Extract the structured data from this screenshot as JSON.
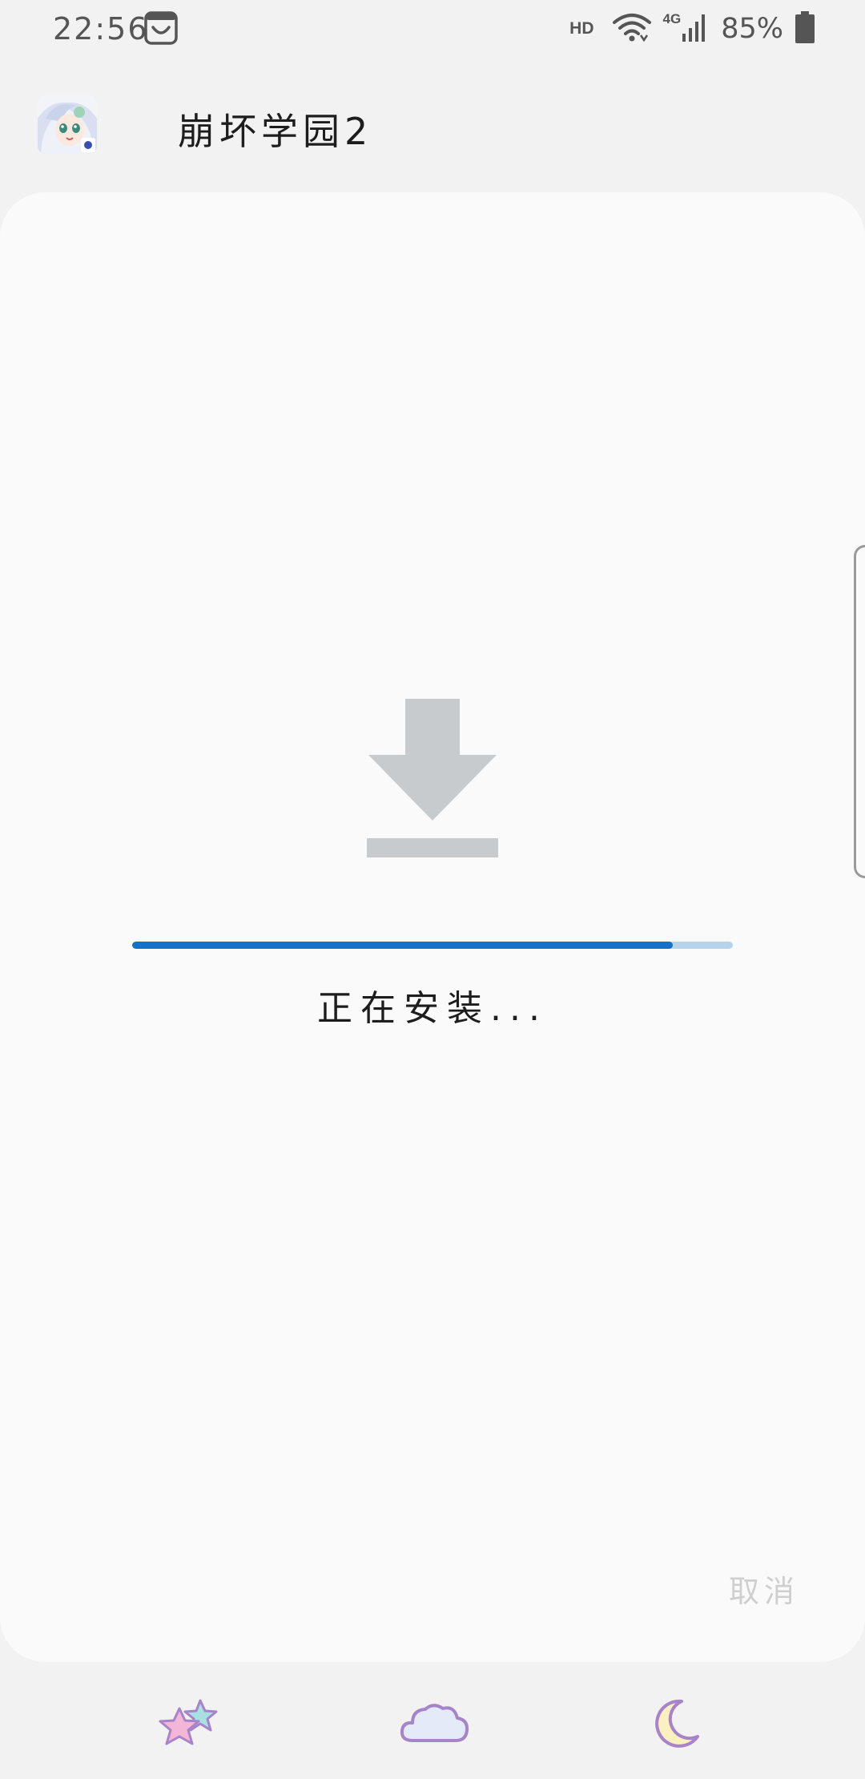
{
  "status_bar": {
    "time": "22:56",
    "hd": "HD",
    "network": "4G",
    "battery": "85%"
  },
  "app": {
    "name": "崩坏学园2",
    "icon": "app-icon-anime-character"
  },
  "install": {
    "status_text": "正在安装...",
    "progress": 0.9
  },
  "actions": {
    "cancel_label": "取消"
  },
  "icons": {
    "notification": "notification-bag-icon",
    "wifi": "wifi-icon",
    "signal": "signal-icon",
    "battery": "battery-icon",
    "download": "download-icon",
    "nav": [
      "stars-icon",
      "cloud-icon",
      "moon-icon"
    ]
  },
  "colors": {
    "accent": "#1471c9",
    "track": "#b5d3ea",
    "download_icon": "#c8cbce",
    "card": "#fafafa",
    "background": "#f2f2f2",
    "cancel_text": "#cfcfcf"
  }
}
